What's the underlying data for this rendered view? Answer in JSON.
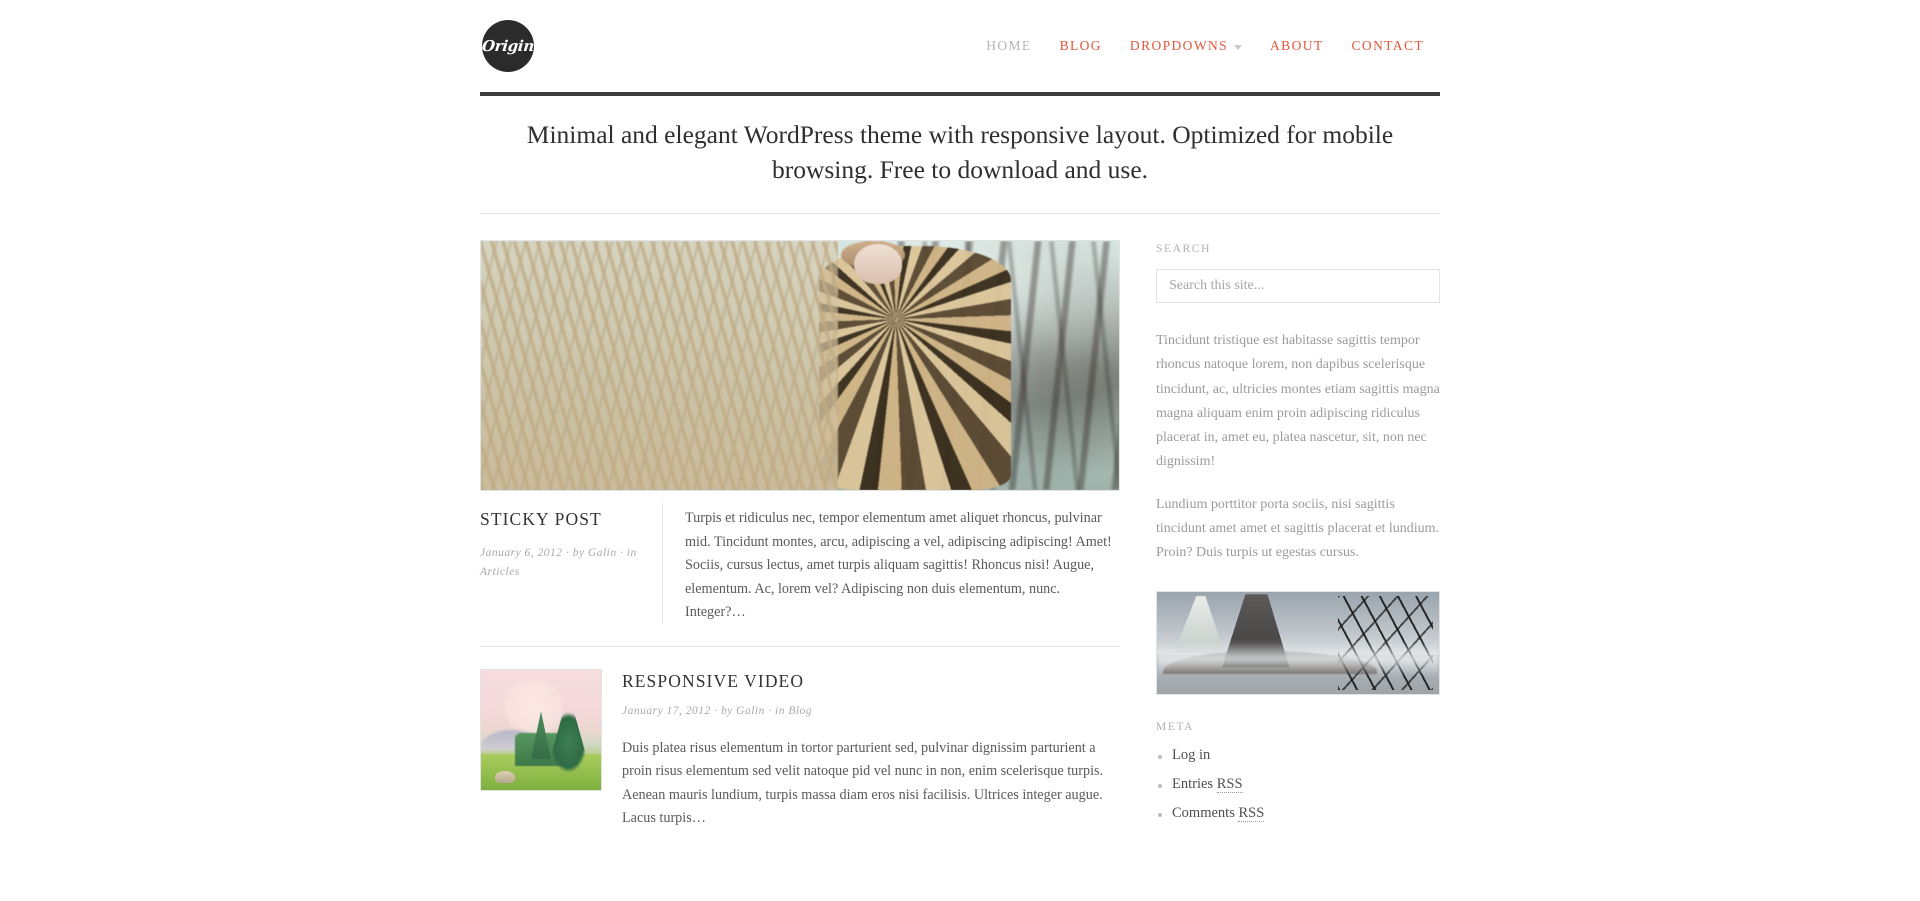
{
  "site": {
    "logo_text": "Origin"
  },
  "nav": {
    "items": [
      {
        "label": "HOME",
        "current": true,
        "dropdown": false
      },
      {
        "label": "BLOG",
        "current": false,
        "dropdown": false
      },
      {
        "label": "DROPDOWNS",
        "current": false,
        "dropdown": true
      },
      {
        "label": "ABOUT",
        "current": false,
        "dropdown": false
      },
      {
        "label": "CONTACT",
        "current": false,
        "dropdown": false
      }
    ],
    "accent_color": "#e2573a",
    "current_color": "#b4b4b4"
  },
  "tagline": {
    "text": "Minimal and elegant WordPress theme with responsive layout. Optimized for mobile browsing. Free to download and use."
  },
  "posts": [
    {
      "id": "sticky-post",
      "title": "STICKY POST",
      "date": "January 6, 2012",
      "author_prefix": "by",
      "author": "Galin",
      "category_prefix": "in",
      "category": "Articles",
      "separator": "·",
      "excerpt": "Turpis et ridiculus nec, tempor elementum amet aliquet rhoncus, pulvinar mid. Tincidunt montes, arcu, adipiscing a vel, adipiscing adipiscing! Amet! Sociis, cursus lectus, amet turpis aliquam sagittis! Rhoncus nisi! Augue, elementum. Ac, lorem vel? Adipiscing non duis elementum, nunc. Integer?…",
      "featured_image_alt": "woman in leopard print coat standing in dry grass field"
    },
    {
      "id": "responsive-video",
      "title": "RESPONSIVE VIDEO",
      "date": "January 17, 2012",
      "author_prefix": "by",
      "author": "Galin",
      "category_prefix": "in",
      "category": "Blog",
      "separator": "·",
      "excerpt": "Duis platea risus elementum in tortor parturient sed, pulvinar dignissim parturient a proin risus elementum sed velit natoque pid vel nunc in non, enim scelerisque turpis. Aenean mauris lundium, turpis massa diam eros nisi facilisis. Ultrices integer augue. Lacus turpis…",
      "thumbnail_alt": "pastel landscape with pink sky, evergreen trees and green meadow"
    }
  ],
  "sidebar": {
    "search": {
      "title": "SEARCH",
      "placeholder": "Search this site...",
      "value": ""
    },
    "text_widget": {
      "paragraph_1": "Tincidunt tristique est habitasse sagittis tempor rhoncus natoque lorem, non dapibus scelerisque tincidunt, ac, ultricies montes etiam sagittis magna magna aliquam enim proin adipiscing ridiculus placerat in, amet eu, platea nascetur, sit, non nec dignissim!",
      "paragraph_2": "Lundium porttitor porta sociis, nisi sagittis tincidunt amet amet et sagittis placerat et lundium. Proin? Duis turpis ut egestas cursus."
    },
    "image_widget": {
      "alt": "misty gray lake scene with bare tree and pale dress"
    },
    "meta": {
      "title": "META",
      "items": [
        {
          "label": "Log in",
          "abbr": ""
        },
        {
          "label": "Entries ",
          "abbr": "RSS"
        },
        {
          "label": "Comments ",
          "abbr": "RSS"
        }
      ]
    }
  }
}
